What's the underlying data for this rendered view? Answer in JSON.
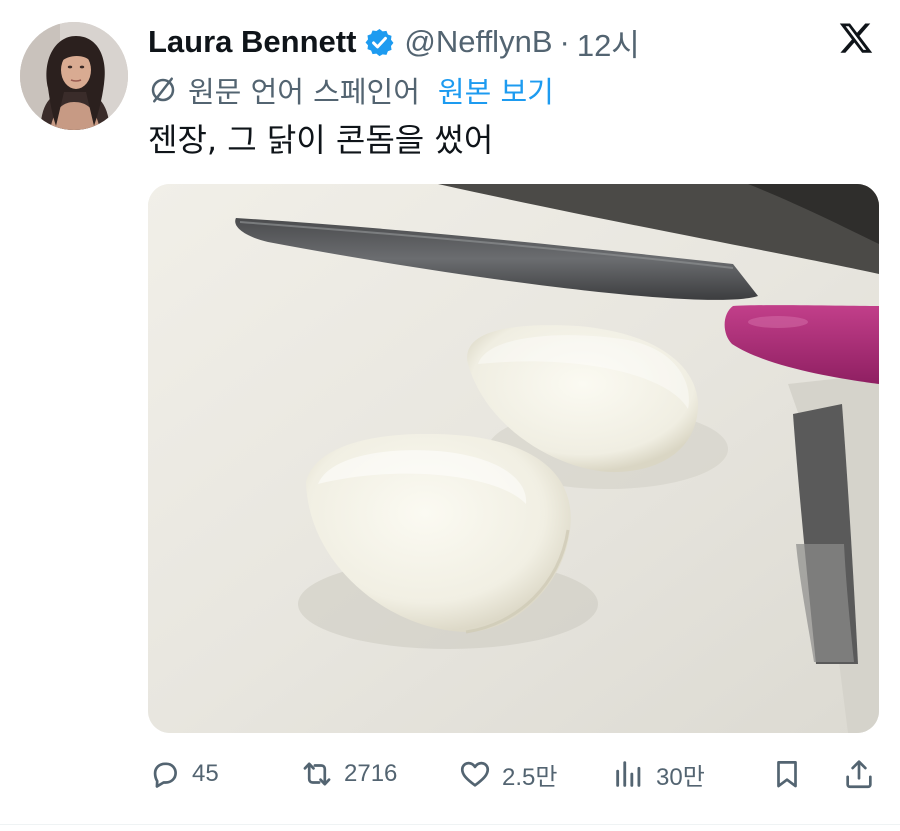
{
  "author": {
    "name": "Laura Bennett",
    "handle": "@NefflynB",
    "separator": "·",
    "time": "12시",
    "verified": true
  },
  "translation": {
    "note": "원문 언어 스페인어",
    "show_original_label": "원본 보기"
  },
  "tweet": {
    "text": "젠장, 그 닭이 콘돔을 썼어"
  },
  "actions": {
    "reply_count": "45",
    "retweet_count": "2716",
    "like_count": "2.5만",
    "view_count": "30만"
  },
  "icons": {
    "globe": "translate-globe-icon",
    "verified": "verified-badge-icon",
    "logo": "x-logo-icon",
    "reply": "reply-icon",
    "retweet": "retweet-icon",
    "like": "heart-icon",
    "views": "views-icon",
    "bookmark": "bookmark-icon",
    "share": "share-icon"
  },
  "colors": {
    "accent": "#1d9bf0",
    "secondary_text": "#536471",
    "primary_text": "#0f1419"
  }
}
